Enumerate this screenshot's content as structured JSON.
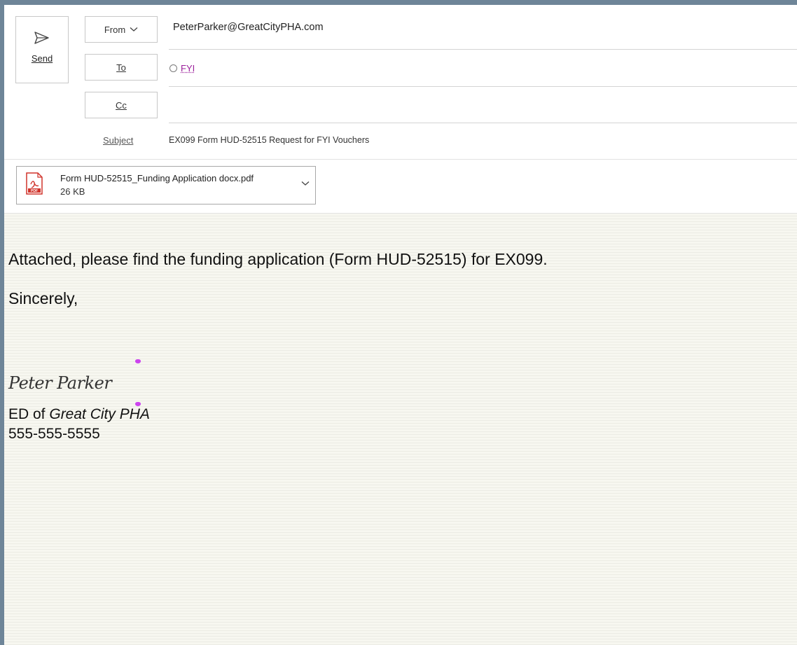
{
  "compose": {
    "send_label": "Send",
    "from_label": "From",
    "from_value": "PeterParker@GreatCityPHA.com",
    "to_label": "To",
    "to_value": "FYI",
    "cc_label": "Cc",
    "subject_label": "Subject",
    "subject_value": "EX099 Form HUD-52515 Request for FYI Vouchers"
  },
  "attachment": {
    "name": "Form HUD-52515_Funding Application docx.pdf",
    "size": "26 KB",
    "icon": "pdf-file-icon"
  },
  "message": {
    "line1": "Attached, please find the funding application (Form HUD-52515) for EX099.",
    "closing": "Sincerely,",
    "signature_name": "Peter Parker",
    "title_prefix": "ED of ",
    "title_org": "Great City PHA",
    "phone": "555-555-5555"
  },
  "colors": {
    "window_frame": "#6e8598",
    "recipient_link": "#9b1f9b",
    "body_background": "#f6f6ef"
  }
}
